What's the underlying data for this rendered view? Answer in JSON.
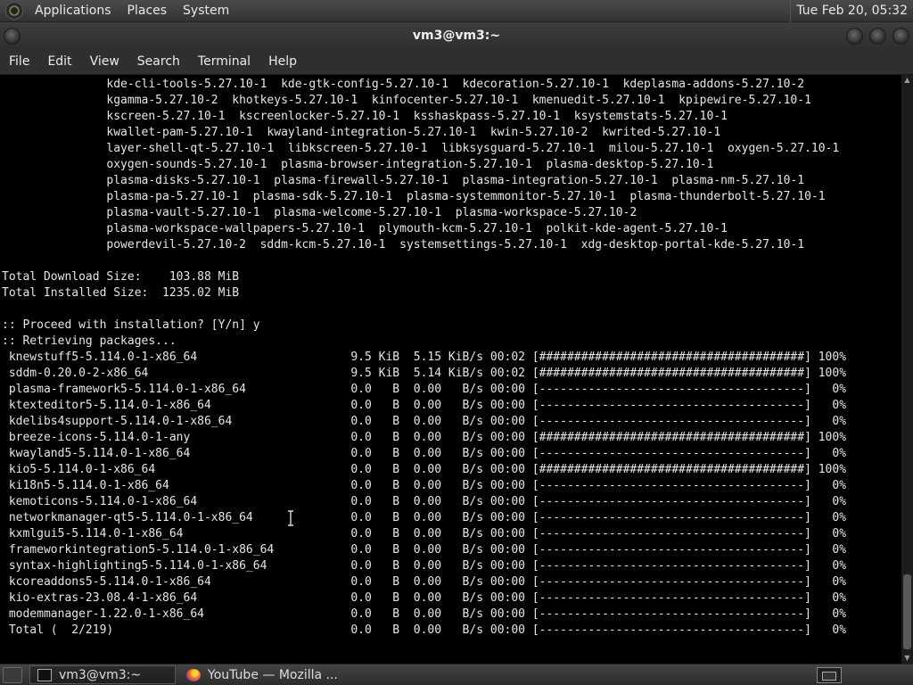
{
  "top_panel": {
    "menus": [
      "Applications",
      "Places",
      "System"
    ],
    "clock": "Tue Feb 20, 05:32"
  },
  "window": {
    "title": "vm3@vm3:~"
  },
  "menubar": [
    "File",
    "Edit",
    "View",
    "Search",
    "Terminal",
    "Help"
  ],
  "terminal": {
    "lines": [
      "               kde-cli-tools-5.27.10-1  kde-gtk-config-5.27.10-1  kdecoration-5.27.10-1  kdeplasma-addons-5.27.10-2",
      "               kgamma-5.27.10-2  khotkeys-5.27.10-1  kinfocenter-5.27.10-1  kmenuedit-5.27.10-1  kpipewire-5.27.10-1",
      "               kscreen-5.27.10-1  kscreenlocker-5.27.10-1  ksshaskpass-5.27.10-1  ksystemstats-5.27.10-1",
      "               kwallet-pam-5.27.10-1  kwayland-integration-5.27.10-1  kwin-5.27.10-2  kwrited-5.27.10-1",
      "               layer-shell-qt-5.27.10-1  libkscreen-5.27.10-1  libksysguard-5.27.10-1  milou-5.27.10-1  oxygen-5.27.10-1",
      "               oxygen-sounds-5.27.10-1  plasma-browser-integration-5.27.10-1  plasma-desktop-5.27.10-1",
      "               plasma-disks-5.27.10-1  plasma-firewall-5.27.10-1  plasma-integration-5.27.10-1  plasma-nm-5.27.10-1",
      "               plasma-pa-5.27.10-1  plasma-sdk-5.27.10-1  plasma-systemmonitor-5.27.10-1  plasma-thunderbolt-5.27.10-1",
      "               plasma-vault-5.27.10-1  plasma-welcome-5.27.10-1  plasma-workspace-5.27.10-2",
      "               plasma-workspace-wallpapers-5.27.10-1  plymouth-kcm-5.27.10-1  polkit-kde-agent-5.27.10-1",
      "               powerdevil-5.27.10-2  sddm-kcm-5.27.10-1  systemsettings-5.27.10-1  xdg-desktop-portal-kde-5.27.10-1",
      "",
      "Total Download Size:    103.88 MiB",
      "Total Installed Size:  1235.02 MiB",
      "",
      ":: Proceed with installation? [Y/n] y",
      ":: Retrieving packages...",
      " knewstuff5-5.114.0-1-x86_64                      9.5 KiB  5.15 KiB/s 00:02 [######################################] 100%",
      " sddm-0.20.0-2-x86_64                             9.5 KiB  5.14 KiB/s 00:02 [######################################] 100%",
      " plasma-framework5-5.114.0-1-x86_64               0.0   B  0.00   B/s 00:00 [--------------------------------------]   0%",
      " ktexteditor5-5.114.0-1-x86_64                    0.0   B  0.00   B/s 00:00 [--------------------------------------]   0%",
      " kdelibs4support-5.114.0-1-x86_64                 0.0   B  0.00   B/s 00:00 [--------------------------------------]   0%",
      " breeze-icons-5.114.0-1-any                       0.0   B  0.00   B/s 00:00 [######################################] 100%",
      " kwayland5-5.114.0-1-x86_64                       0.0   B  0.00   B/s 00:00 [--------------------------------------]   0%",
      " kio5-5.114.0-1-x86_64                            0.0   B  0.00   B/s 00:00 [######################################] 100%",
      " ki18n5-5.114.0-1-x86_64                          0.0   B  0.00   B/s 00:00 [--------------------------------------]   0%",
      " kemoticons-5.114.0-1-x86_64                      0.0   B  0.00   B/s 00:00 [--------------------------------------]   0%",
      " networkmanager-qt5-5.114.0-1-x86_64              0.0   B  0.00   B/s 00:00 [--------------------------------------]   0%",
      " kxmlgui5-5.114.0-1-x86_64                        0.0   B  0.00   B/s 00:00 [--------------------------------------]   0%",
      " frameworkintegration5-5.114.0-1-x86_64           0.0   B  0.00   B/s 00:00 [--------------------------------------]   0%",
      " syntax-highlighting5-5.114.0-1-x86_64            0.0   B  0.00   B/s 00:00 [--------------------------------------]   0%",
      " kcoreaddons5-5.114.0-1-x86_64                    0.0   B  0.00   B/s 00:00 [--------------------------------------]   0%",
      " kio-extras-23.08.4-1-x86_64                      0.0   B  0.00   B/s 00:00 [--------------------------------------]   0%",
      " modemmanager-1.22.0-1-x86_64                     0.0   B  0.00   B/s 00:00 [--------------------------------------]   0%",
      " Total (  2/219)                                  0.0   B  0.00   B/s 00:00 [--------------------------------------]   0%"
    ]
  },
  "taskbar": {
    "tasks": [
      "vm3@vm3:~",
      "YouTube — Mozilla ..."
    ]
  }
}
